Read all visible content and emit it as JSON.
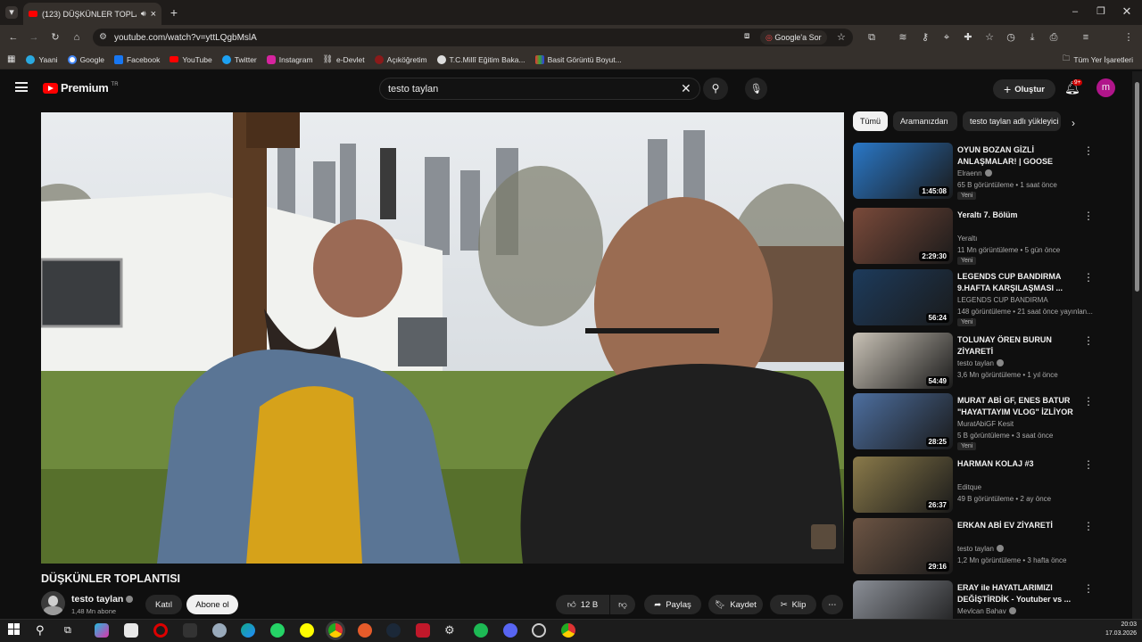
{
  "browser": {
    "tab_title": "(123) DÜŞKÜNLER TOPLANTISI",
    "url": "youtube.com/watch?v=yttLQgbMslA",
    "google_ask": "Google'a Sor",
    "bookmarks": [
      "Yaani",
      "Google",
      "Facebook",
      "YouTube",
      "Twitter",
      "Instagram",
      "e-Devlet",
      "Açıköğretim",
      "T.C.Millî Eğitim Baka...",
      "Basit Görüntü Boyut..."
    ],
    "all_bookmarks": "Tüm Yer İşaretleri",
    "profile_initial": "m"
  },
  "youtube": {
    "logo": "Premium",
    "logo_region": "TR",
    "search_query": "testo taylan",
    "create_label": "Oluştur",
    "notif_badge": "9+",
    "avatar_initial": "m"
  },
  "video": {
    "title": "DÜŞKÜNLER TOPLANTISI",
    "channel": "testo taylan",
    "subscribers": "1,48 Mn abone",
    "join_label": "Katıl",
    "subscribe_label": "Abone ol",
    "likes": "12 B",
    "share_label": "Paylaş",
    "save_label": "Kaydet",
    "clip_label": "Klip"
  },
  "chips": [
    "Tümü",
    "Aramanızdan",
    "testo taylan adlı yükleyici"
  ],
  "recommendations": [
    {
      "title": "OYUN BOZAN GİZLİ ANLAŞMALAR! | GOOSE GOO...",
      "channel": "Elraenn",
      "verified": true,
      "meta": "65 B görüntüleme • 1 saat önce",
      "duration": "1:45:08",
      "badge": "Yeni",
      "color": "#2a78c8"
    },
    {
      "title": "Yeraltı 7. Bölüm",
      "channel": "Yeraltı",
      "verified": false,
      "meta": "11 Mn görüntüleme • 5 gün önce",
      "duration": "2:29:30",
      "badge": "Yeni",
      "color": "#7a4a3a"
    },
    {
      "title": "LEGENDS CUP BANDIRMA 9.HAFTA KARŞILAŞMASI ...",
      "channel": "LEGENDS CUP BANDIRMA",
      "verified": false,
      "meta": "148 görüntüleme • 21 saat önce yayınlan...",
      "duration": "56:24",
      "badge": "Yeni",
      "color": "#1d3b5c"
    },
    {
      "title": "TOLUNAY ÖREN BURUN ZİYARETİ",
      "channel": "testo taylan",
      "verified": true,
      "meta": "3,6 Mn görüntüleme • 1 yıl önce",
      "duration": "54:49",
      "badge": "",
      "color": "#c9c2b6"
    },
    {
      "title": "MURAT ABİ GF, ENES BATUR \"HAYATTAYIM VLOG\" İZLİYOR ...",
      "channel": "MuratAbiGF Kesit",
      "verified": false,
      "meta": "5 B görüntüleme • 3 saat önce",
      "duration": "28:25",
      "badge": "Yeni",
      "color": "#4d6fa0"
    },
    {
      "title": "HARMAN KOLAJ #3",
      "channel": "Editque",
      "verified": false,
      "meta": "49 B görüntüleme • 2 ay önce",
      "duration": "26:37",
      "badge": "",
      "color": "#8a7a4a"
    },
    {
      "title": "ERKAN ABİ EV ZİYARETİ",
      "channel": "testo taylan",
      "verified": true,
      "meta": "1,2 Mn görüntüleme • 3 hafta önce",
      "duration": "29:16",
      "badge": "",
      "color": "#6d5544"
    },
    {
      "title": "ERAY ile HAYATLARIMIZI DEĞİŞTİRDİK - Youtuber vs ...",
      "channel": "Mevlcan Bahav",
      "verified": true,
      "meta": "",
      "duration": "",
      "badge": "",
      "color": "#8a8e96"
    }
  ],
  "taskbar": {
    "time": "20:03",
    "date": "17.03.2026"
  }
}
